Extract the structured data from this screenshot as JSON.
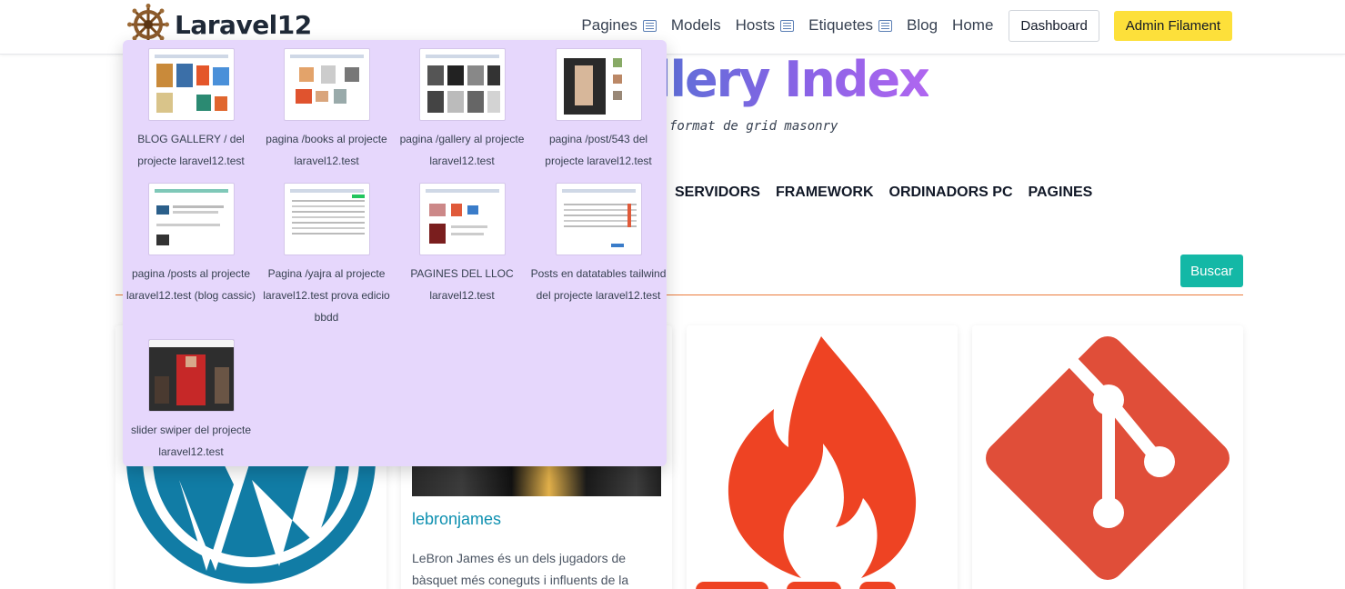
{
  "brand": {
    "name": "Laravel12",
    "logo": "ship-wheel-icon"
  },
  "nav": {
    "pagines": "Pagines",
    "models": "Models",
    "hosts": "Hosts",
    "etiquetes": "Etiquetes",
    "blog": "Blog",
    "home": "Home",
    "dashboard": "Dashboard",
    "admin": "Admin Filament"
  },
  "hero": {
    "title": "llery Index",
    "subtitle": "format de grid masonry"
  },
  "categories": [
    "SERVIDORS",
    "FRAMEWORK",
    "ORDINADORS PC",
    "PAGINES"
  ],
  "search": {
    "button": "Buscar"
  },
  "cards": [
    {
      "title": "",
      "text": ""
    },
    {
      "title": "lebronjames",
      "text": "LeBron James és un dels jugadors de bàsquet més coneguts i influents de la"
    },
    {
      "title": "",
      "text": ""
    },
    {
      "title": "",
      "text": ""
    }
  ],
  "dropdown": {
    "items": [
      {
        "label": "BLOG GALLERY / del projecte laravel12.test"
      },
      {
        "label": "pagina /books al projecte laravel12.test"
      },
      {
        "label": "pagina /gallery al projecte laravel12.test"
      },
      {
        "label": "pagina /post/543 del projecte laravel12.test"
      },
      {
        "label": "pagina /posts al projecte laravel12.test (blog cassic)"
      },
      {
        "label": "Pagina /yajra al projecte laravel12.test prova edicio bbdd"
      },
      {
        "label": "PAGINES DEL LLOC laravel12.test"
      },
      {
        "label": "Posts en datatables tailwind del projecte laravel12.test"
      },
      {
        "label": "slider swiper del projecte laravel12.test"
      }
    ]
  },
  "colors": {
    "accent_teal": "#14b8a6",
    "admin_yellow": "#fde03a",
    "dropdown_bg": "#e6d7fc",
    "divider_orange": "#ea7a3b",
    "title_link": "#0e90b0"
  }
}
